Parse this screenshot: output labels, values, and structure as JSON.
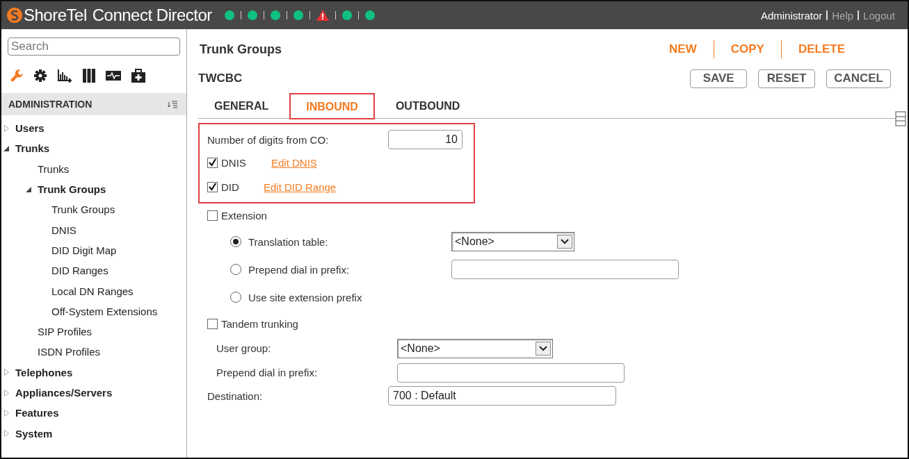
{
  "header": {
    "logo_text": "ShoreTel",
    "title": "Connect Director",
    "status": [
      {
        "kind": "ok"
      },
      {
        "kind": "ok"
      },
      {
        "kind": "ok"
      },
      {
        "kind": "ok"
      },
      {
        "kind": "warning"
      },
      {
        "kind": "ok"
      },
      {
        "kind": "ok"
      }
    ],
    "user": "Administrator",
    "links": [
      "Help",
      "Logout"
    ]
  },
  "sidebar": {
    "search": {
      "placeholder": "Search"
    },
    "toolbar": [
      {
        "kind": "wrench",
        "selected": true
      },
      {
        "kind": "gear",
        "selected": false
      },
      {
        "kind": "chart",
        "selected": false
      },
      {
        "kind": "books",
        "selected": false
      },
      {
        "kind": "monitor",
        "selected": false
      },
      {
        "kind": "kit",
        "selected": false
      }
    ],
    "section": "ADMINISTRATION",
    "tree": [
      {
        "label": "Users",
        "expanded": false
      },
      {
        "label": "Trunks",
        "expanded": true,
        "children": [
          {
            "label": "Trunks"
          },
          {
            "label": "Trunk Groups",
            "expanded": true,
            "children": [
              {
                "label": "Trunk Groups"
              },
              {
                "label": "DNIS"
              },
              {
                "label": "DID Digit Map"
              },
              {
                "label": "DID Ranges"
              },
              {
                "label": "Local DN Ranges"
              },
              {
                "label": "Off-System Extensions"
              }
            ]
          },
          {
            "label": "SIP Profiles"
          },
          {
            "label": "ISDN Profiles"
          }
        ]
      },
      {
        "label": "Telephones",
        "expanded": false
      },
      {
        "label": "Appliances/Servers",
        "expanded": false
      },
      {
        "label": "Features",
        "expanded": false
      },
      {
        "label": "System",
        "expanded": false
      }
    ]
  },
  "page": {
    "title": "Trunk Groups",
    "actions": [
      "NEW",
      "COPY",
      "DELETE"
    ],
    "record": "TWCBC",
    "buttons": [
      "SAVE",
      "RESET",
      "CANCEL"
    ],
    "tabs": [
      {
        "label": "GENERAL",
        "selected": false,
        "highlighted": false
      },
      {
        "label": "INBOUND",
        "selected": true,
        "highlighted": true
      },
      {
        "label": "OUTBOUND",
        "selected": false,
        "highlighted": false
      }
    ]
  },
  "inbound": {
    "highlighted": true,
    "digits_label": "Number of digits from CO:",
    "digits_value": "10",
    "dnis": {
      "label": "DNIS",
      "checked": true,
      "link": "Edit DNIS"
    },
    "did": {
      "label": "DID",
      "checked": true,
      "link": "Edit DID Range"
    }
  },
  "extension": {
    "label": "Extension",
    "checked": false,
    "options": [
      {
        "kind": "select",
        "label": "Translation table:",
        "selected": true,
        "value": "<None>"
      },
      {
        "kind": "input",
        "label": "Prepend dial in prefix:",
        "selected": false
      },
      {
        "kind": "none",
        "label": "Use site extension prefix",
        "selected": false
      }
    ]
  },
  "tandem": {
    "label": "Tandem trunking",
    "checked": false,
    "user_group_label": "User group:",
    "user_group_value": "<None>",
    "prepend_label": "Prepend dial in prefix:"
  },
  "destination": {
    "label": "Destination:",
    "value": "700 : Default"
  }
}
